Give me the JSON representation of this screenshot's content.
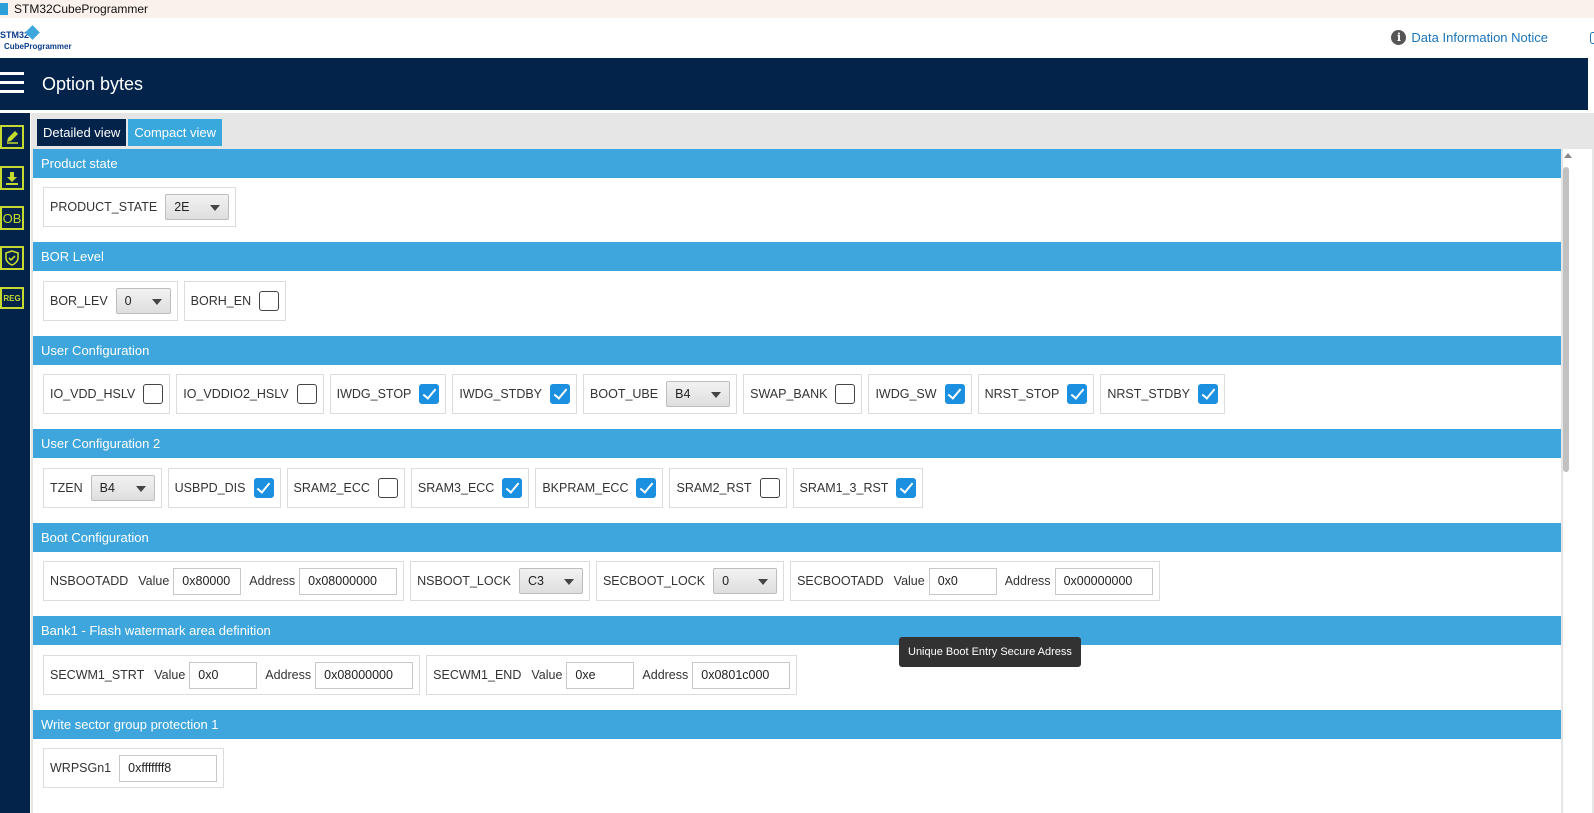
{
  "window": {
    "title": "STM32CubeProgrammer"
  },
  "header": {
    "logo_text_1": "STM32",
    "logo_text_2": "CubeProgrammer",
    "notice_label": "Data Information Notice"
  },
  "navbar": {
    "title": "Option bytes"
  },
  "sidebar": {
    "items": [
      "pencil-icon",
      "download-icon",
      "OB",
      "shield-icon",
      "REG"
    ]
  },
  "tabs": [
    {
      "label": "Detailed view",
      "active": true
    },
    {
      "label": "Compact view",
      "active": false
    }
  ],
  "sections": {
    "product_state": {
      "title": "Product state",
      "product_state_label": "PRODUCT_STATE",
      "product_state_value": "2E"
    },
    "bor_level": {
      "title": "BOR Level",
      "bor_lev_label": "BOR_LEV",
      "bor_lev_value": "0",
      "borh_en_label": "BORH_EN",
      "borh_en_checked": false
    },
    "user_config": {
      "title": "User Configuration",
      "io_vdd_hslv": {
        "label": "IO_VDD_HSLV",
        "checked": false
      },
      "io_vddio2_hslv": {
        "label": "IO_VDDIO2_HSLV",
        "checked": false
      },
      "iwdg_stop": {
        "label": "IWDG_STOP",
        "checked": true
      },
      "iwdg_stdby": {
        "label": "IWDG_STDBY",
        "checked": true
      },
      "boot_ube": {
        "label": "BOOT_UBE",
        "value": "B4"
      },
      "swap_bank": {
        "label": "SWAP_BANK",
        "checked": false
      },
      "iwdg_sw": {
        "label": "IWDG_SW",
        "checked": true
      },
      "nrst_stop": {
        "label": "NRST_STOP",
        "checked": true
      },
      "nrst_stdby": {
        "label": "NRST_STDBY",
        "checked": true
      }
    },
    "user_config_2": {
      "title": "User Configuration 2",
      "tzen": {
        "label": "TZEN",
        "value": "B4"
      },
      "usbpd_dis": {
        "label": "USBPD_DIS",
        "checked": true
      },
      "sram2_ecc": {
        "label": "SRAM2_ECC",
        "checked": false
      },
      "sram3_ecc": {
        "label": "SRAM3_ECC",
        "checked": true
      },
      "bkpram_ecc": {
        "label": "BKPRAM_ECC",
        "checked": true
      },
      "sram2_rst": {
        "label": "SRAM2_RST",
        "checked": false
      },
      "sram1_3_rst": {
        "label": "SRAM1_3_RST",
        "checked": true
      }
    },
    "boot_config": {
      "title": "Boot Configuration",
      "nsbootadd": {
        "label": "NSBOOTADD",
        "value_label": "Value",
        "value": "0x80000",
        "address_label": "Address",
        "address": "0x08000000"
      },
      "nsboot_lock": {
        "label": "NSBOOT_LOCK",
        "value": "C3"
      },
      "secboot_lock": {
        "label": "SECBOOT_LOCK",
        "value": "0"
      },
      "secbootadd": {
        "label": "SECBOOTADD",
        "value_label": "Value",
        "value": "0x0",
        "address_label": "Address",
        "address": "0x00000000"
      }
    },
    "bank1_watermark": {
      "title": "Bank1 - Flash watermark area definition",
      "secwm1_strt": {
        "label": "SECWM1_STRT",
        "value_label": "Value",
        "value": "0x0",
        "address_label": "Address",
        "address": "0x08000000"
      },
      "secwm1_end": {
        "label": "SECWM1_END",
        "value_label": "Value",
        "value": "0xe",
        "address_label": "Address",
        "address": "0x0801c000"
      }
    },
    "write_protection_1": {
      "title": "Write sector group protection 1",
      "wrpsgn1": {
        "label": "WRPSGn1",
        "value": "0xfffffff8"
      }
    }
  },
  "tooltip": {
    "text": "Unique Boot Entry Secure Adress"
  },
  "colors": {
    "navy": "#03234b",
    "section_blue": "#3ea6dc",
    "checkbox_blue": "#1b8fe0",
    "sidebar_icon": "#c6d92e"
  }
}
